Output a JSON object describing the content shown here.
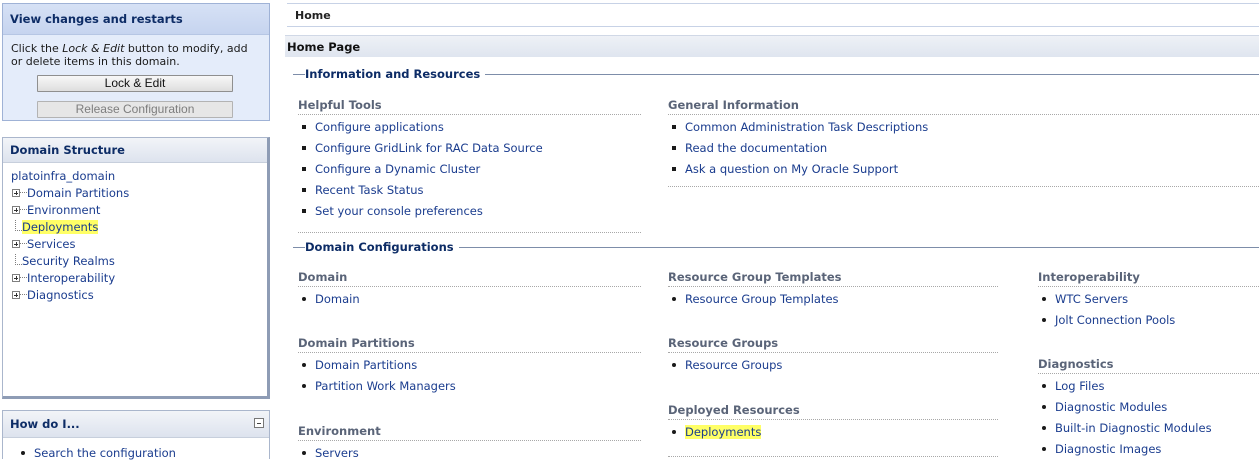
{
  "change_center": {
    "title": "View changes and restarts",
    "message_pre": "Click the ",
    "message_em": "Lock & Edit",
    "message_post": " button to modify, add or delete items in this domain.",
    "lock_edit_label": "Lock & Edit",
    "release_label": "Release Configuration"
  },
  "domain_structure": {
    "title": "Domain Structure",
    "root": "platoinfra_domain",
    "items": [
      {
        "label": "Domain Partitions",
        "expandable": true
      },
      {
        "label": "Environment",
        "expandable": true
      },
      {
        "label": "Deployments",
        "expandable": false,
        "highlighted": true
      },
      {
        "label": "Services",
        "expandable": true
      },
      {
        "label": "Security Realms",
        "expandable": false
      },
      {
        "label": "Interoperability",
        "expandable": true
      },
      {
        "label": "Diagnostics",
        "expandable": true
      }
    ]
  },
  "how_do_i": {
    "title": "How do I...",
    "items": [
      "Search the configuration"
    ]
  },
  "breadcrumb": "Home",
  "page_title": "Home Page",
  "info_section": {
    "title": "Information and Resources",
    "helpful_tools": {
      "title": "Helpful Tools",
      "items": [
        "Configure applications",
        "Configure GridLink for RAC Data Source",
        "Configure a Dynamic Cluster",
        "Recent Task Status",
        "Set your console preferences"
      ]
    },
    "general_info": {
      "title": "General Information",
      "items": [
        "Common Administration Task Descriptions",
        "Read the documentation",
        "Ask a question on My Oracle Support"
      ]
    }
  },
  "domain_config": {
    "title": "Domain Configurations",
    "domain": {
      "title": "Domain",
      "items": [
        "Domain"
      ]
    },
    "domain_partitions": {
      "title": "Domain Partitions",
      "items": [
        "Domain Partitions",
        "Partition Work Managers"
      ]
    },
    "environment": {
      "title": "Environment",
      "items": [
        "Servers"
      ]
    },
    "rg_templates": {
      "title": "Resource Group Templates",
      "items": [
        "Resource Group Templates"
      ]
    },
    "resource_groups": {
      "title": "Resource Groups",
      "items": [
        "Resource Groups"
      ]
    },
    "deployed_resources": {
      "title": "Deployed Resources",
      "items": [
        "Deployments"
      ]
    },
    "interoperability": {
      "title": "Interoperability",
      "items": [
        "WTC Servers",
        "Jolt Connection Pools"
      ]
    },
    "diagnostics": {
      "title": "Diagnostics",
      "items": [
        "Log Files",
        "Diagnostic Modules",
        "Built-in Diagnostic Modules",
        "Diagnostic Images"
      ]
    }
  },
  "colors": {
    "highlight": "#ffff66",
    "link": "#1a3c8e",
    "header_text": "#0d2c66"
  }
}
